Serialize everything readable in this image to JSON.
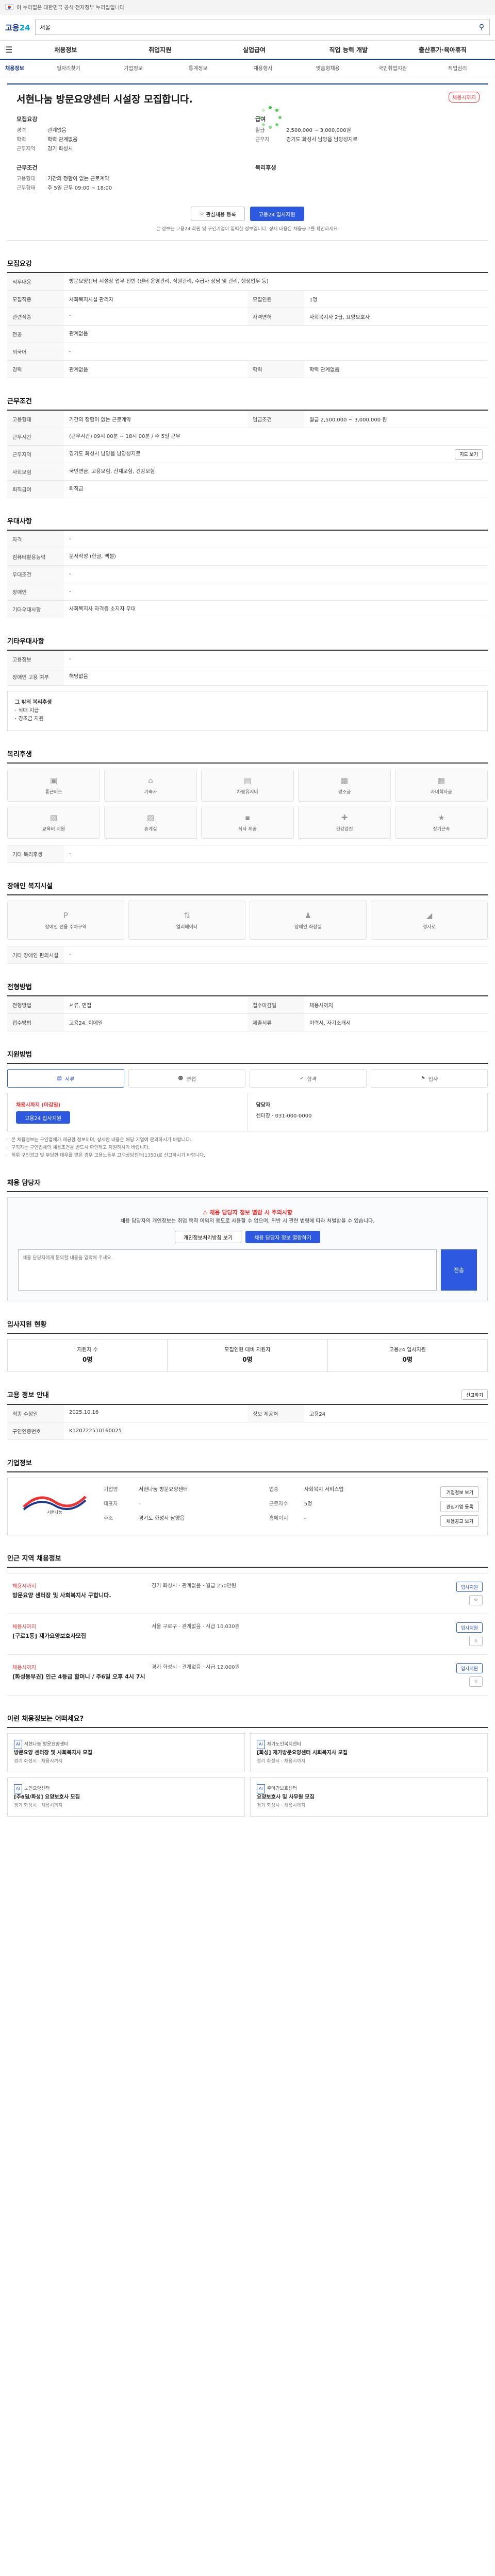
{
  "gov_banner": {
    "text": "이 누리집은 대한민국 공식 전자정부 누리집입니다."
  },
  "header": {
    "logo_a": "고용",
    "logo_b": "24",
    "search_value": "서울"
  },
  "gnb": [
    "채용정보",
    "취업지원",
    "실업급여",
    "직업 능력 개발",
    "출산휴가·육아휴직"
  ],
  "subnav": [
    "채용정보",
    "일자리찾기",
    "기업정보",
    "통계정보",
    "채용행사",
    "맞춤형채용",
    "국민취업지원",
    "직업심리"
  ],
  "job": {
    "title": "서현나눔 방문요양센터 시설장 모집합니다.",
    "status": "채용시까지",
    "recruit_title": "모집요강",
    "rows": [
      {
        "k": "경력",
        "v": "관계없음"
      },
      {
        "k": "학력",
        "v": "학력 관계없음"
      },
      {
        "k": "근무지역",
        "v": "경기 화성시"
      }
    ],
    "salary_title": "급여",
    "salary_rows": [
      {
        "k": "월급",
        "v": "2,500,000 ~ 3,000,000원"
      },
      {
        "k": "근무지",
        "v": "경기도 화성시 남양읍 남양성지로"
      }
    ],
    "cond_title": "근무조건",
    "cond_rows": [
      {
        "k": "고용형태",
        "v": "기간의 정함이 없는 근로계약"
      },
      {
        "k": "근무형태",
        "v": "주 5일 근무 09:00 ~ 18:00"
      }
    ],
    "welfare_title": "복리후생",
    "btn_scrap": "관심채용 등록",
    "btn_apply": "고용24 입사지원",
    "notice": "본 정보는 고용24 회원 및 구인기업이 입력한 정보입니다. 상세 내용은 채용공고를 확인하세요."
  },
  "sections": {
    "duty": "모집요강",
    "cond": "근무조건",
    "qual": "우대사항",
    "other": "기타우대사항",
    "welfare": "복리후생",
    "disabled": "장애인 복지시설",
    "process": "전형방법",
    "apply": "지원방법",
    "contact": "채용 담당자",
    "stat": "입사지원 현황",
    "info": "고용 정보 안내",
    "company": "기업정보",
    "others": "인근 지역 채용정보",
    "recommend": "이런 채용정보는 어떠세요?"
  },
  "duty": {
    "rows": [
      {
        "k": "직무내용",
        "v": "방문요양센터 시설장 업무 전반 (센터 운영관리, 직원관리, 수급자 상담 및 관리, 행정업무 등)"
      },
      {
        "k": "모집직종",
        "v": "사회복지시설 관리자"
      },
      {
        "k": "모집인원",
        "v": "1명"
      },
      {
        "k": "관련직종",
        "v": "-"
      },
      {
        "k": "자격면허",
        "v": "사회복지사 2급, 요양보호사"
      },
      {
        "k": "전공",
        "v": "관계없음"
      },
      {
        "k": "외국어",
        "v": "-"
      },
      {
        "k": "경력",
        "v": "관계없음"
      },
      {
        "k": "학력",
        "v": "학력 관계없음"
      }
    ]
  },
  "cond": {
    "rows": [
      {
        "k": "고용형태",
        "v": "기간의 정함이 없는 근로계약"
      },
      {
        "k": "임금조건",
        "v": "월급 2,500,000 ~ 3,000,000 원"
      },
      {
        "k": "근무시간",
        "v": "(근무시간) 09시 00분 ~ 18시 00분 / 주 5일 근무"
      },
      {
        "k": "근무지역",
        "v": "경기도 화성시 남양읍 남양성지로"
      },
      {
        "k": "사회보험",
        "v": "국민연금, 고용보험, 산재보험, 건강보험"
      },
      {
        "k": "퇴직급여",
        "v": "퇴직금"
      }
    ],
    "map_btn": "지도 보기"
  },
  "qual": {
    "rows": [
      {
        "k": "자격",
        "v": "-"
      },
      {
        "k": "컴퓨터활용능력",
        "v": "문서작성 (한글, 엑셀)"
      },
      {
        "k": "우대조건",
        "v": "-"
      },
      {
        "k": "장애인",
        "v": "-"
      },
      {
        "k": "기타우대사항",
        "v": "사회복지사 자격증 소지자 우대"
      }
    ]
  },
  "other": {
    "rows": [
      {
        "k": "고용정보",
        "v": "-"
      },
      {
        "k": "장애인 고용 여부",
        "v": "해당없음"
      }
    ],
    "box": [
      "그 밖의 복리후생",
      "· 식대 지급",
      "· 경조금 지원"
    ]
  },
  "welfare": {
    "cards": [
      "통근버스",
      "기숙사",
      "차량유지비",
      "경조금",
      "자녀학자금",
      "교육비 지원",
      "휴게실",
      "식사 제공",
      "건강검진",
      "장기근속"
    ],
    "note": "기타 복리후생"
  },
  "disabled": {
    "cards": [
      "장애인 전용 주차구역",
      "엘리베이터",
      "장애인 화장실",
      "경사로"
    ],
    "note": "기타 장애인 편의시설"
  },
  "process": {
    "rows": [
      {
        "k": "전형방법",
        "v": "서류, 면접"
      },
      {
        "k": "접수마감일",
        "v": "채용시까지"
      },
      {
        "k": "접수방법",
        "v": "고용24, 이메일"
      },
      {
        "k": "제출서류",
        "v": "이력서, 자기소개서"
      }
    ]
  },
  "apply": {
    "steps": [
      "서류",
      "면접",
      "합격",
      "입사"
    ],
    "left_title": "채용시까지 (마감일)",
    "left_text": "고용24 입사지원",
    "right_title": "담당자",
    "right_text": "센터장 · 031-000-0000",
    "notes": [
      "본 채용정보는 구인업체가 제공한 정보이며, 상세한 내용은 해당 기업에 문의하시기 바랍니다.",
      "구직자는 구인업체의 채용조건을 반드시 확인하고 지원하시기 바랍니다.",
      "허위 구인광고 및 부당한 대우를 받은 경우 고용노동부 고객상담센터(1350)로 신고하시기 바랍니다."
    ]
  },
  "contact": {
    "warn": "채용 담당자 정보 열람 시 주의사항",
    "text": "채용 담당자의 개인정보는 취업 목적 이외의 용도로 사용할 수 없으며, 위반 시 관련 법령에 따라 처벌받을 수 있습니다.",
    "btn1": "개인정보처리방침 보기",
    "btn2": "채용 담당자 정보 열람하기",
    "placeholder": "채용 담당자에게 문의할 내용을 입력해 주세요.",
    "send": "전송"
  },
  "stat": {
    "items": [
      {
        "label": "지원자 수",
        "value": "0명"
      },
      {
        "label": "모집인원 대비 지원자",
        "value": "0명"
      },
      {
        "label": "고용24 입사지원",
        "value": "0명"
      }
    ]
  },
  "info": {
    "rows": [
      {
        "k": "최종 수정일",
        "v": "2025.10.16"
      },
      {
        "k": "정보 제공처",
        "v": "고용24"
      },
      {
        "k": "구인인증번호",
        "v": "K120722510160025"
      }
    ],
    "btn": "신고하기"
  },
  "company": {
    "logo_text": "서현나눔",
    "rows": [
      {
        "k": "기업명",
        "v": "서현나눔 방문요양센터"
      },
      {
        "k": "업종",
        "v": "사회복지 서비스업"
      },
      {
        "k": "대표자",
        "v": "-"
      },
      {
        "k": "근로자수",
        "v": "5명"
      },
      {
        "k": "주소",
        "v": "경기도 화성시 남양읍"
      },
      {
        "k": "홈페이지",
        "v": "-"
      }
    ],
    "btn1": "기업정보 보기",
    "btn2": "관심기업 등록",
    "btn3": "채용공고 보기"
  },
  "others": [
    {
      "co": "채용시까지",
      "t": "방문요양 센터장 및 사회복지사 구합니다.",
      "m": "경기 화성시 · 관계없음 · 월급 250만원",
      "b": "입사지원"
    },
    {
      "co": "채용시까지",
      "t": "[구로1동] 재가요양보호사모집",
      "m": "서울 구로구 · 관계없음 · 시급 10,030원",
      "b": "입사지원"
    },
    {
      "co": "채용시까지",
      "t": "[화성동부권] 인근 4등급 할머니 / 주6일 오후 4시 7시",
      "m": "경기 화성시 · 관계없음 · 시급 12,000원",
      "b": "입사지원"
    }
  ],
  "recommend": [
    {
      "co": "서현나눔 방문요양센터",
      "t": "방문요양 센터장 및 사회복지사 모집",
      "meta": "경기 화성시 · 채용시까지"
    },
    {
      "co": "재가노인복지센터",
      "t": "[화성] 재가방문요양센터 사회복지사 모집",
      "meta": "경기 화성시 · 채용시까지"
    },
    {
      "co": "노인요양센터",
      "t": "[주6일/화성] 요양보호사 모집",
      "meta": "경기 화성시 · 채용시까지"
    },
    {
      "co": "주야간보호센터",
      "t": "요양보호사 및 사무원 모집",
      "meta": "경기 화성시 · 채용시까지"
    }
  ]
}
